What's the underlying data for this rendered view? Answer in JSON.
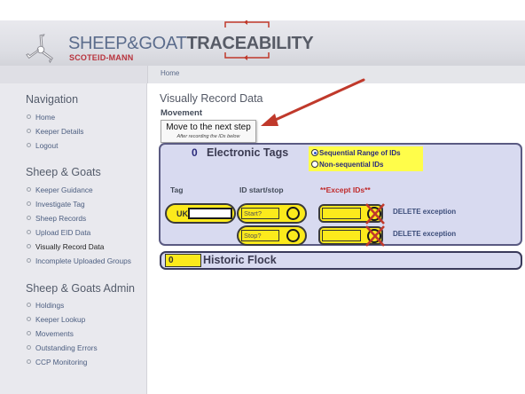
{
  "header": {
    "title_part1": "SHEEP&GOAT",
    "title_part2": "TRACEABILITY",
    "subtitle": "SCOTEID-MANN"
  },
  "breadcrumb": {
    "home": "Home"
  },
  "sidebar": {
    "nav_heading": "Navigation",
    "nav_items": [
      "Home",
      "Keeper Details",
      "Logout"
    ],
    "sg_heading": "Sheep & Goats",
    "sg_items": [
      "Keeper Guidance",
      "Investigate Tag",
      "Sheep Records",
      "Upload EID Data",
      "Visually Record Data",
      "Incomplete Uploaded Groups"
    ],
    "sg_active": "Visually Record Data",
    "admin_heading": "Sheep & Goats Admin",
    "admin_items": [
      "Holdings",
      "Keeper Lookup",
      "Movements",
      "Outstanding Errors",
      "CCP Monitoring"
    ]
  },
  "main": {
    "page_title": "Visually Record Data",
    "section_label": "Movement",
    "next_button": {
      "label": "Move to the next step",
      "sublabel": "After recording the IDs below"
    },
    "eid": {
      "count": "0",
      "title": "Electronic Tags",
      "radio_options": [
        "Sequential Range of IDs",
        "Non-sequential IDs"
      ],
      "radio_selected": "Sequential Range of IDs",
      "col_tag": "Tag",
      "col_id": "ID start/stop",
      "col_except": "**Except IDs**",
      "country_code": "UK",
      "tag_value": "",
      "start_placeholder": "Start?",
      "stop_placeholder": "Stop?",
      "delete_label": "DELETE exception"
    },
    "historic": {
      "count": "0",
      "title": "Historic Flock"
    }
  },
  "colors": {
    "accent_yellow": "#fcea1c",
    "panel_lavender": "#d8daf0",
    "annotation_red": "#c0392b",
    "link_blue": "#3c4d7a"
  }
}
